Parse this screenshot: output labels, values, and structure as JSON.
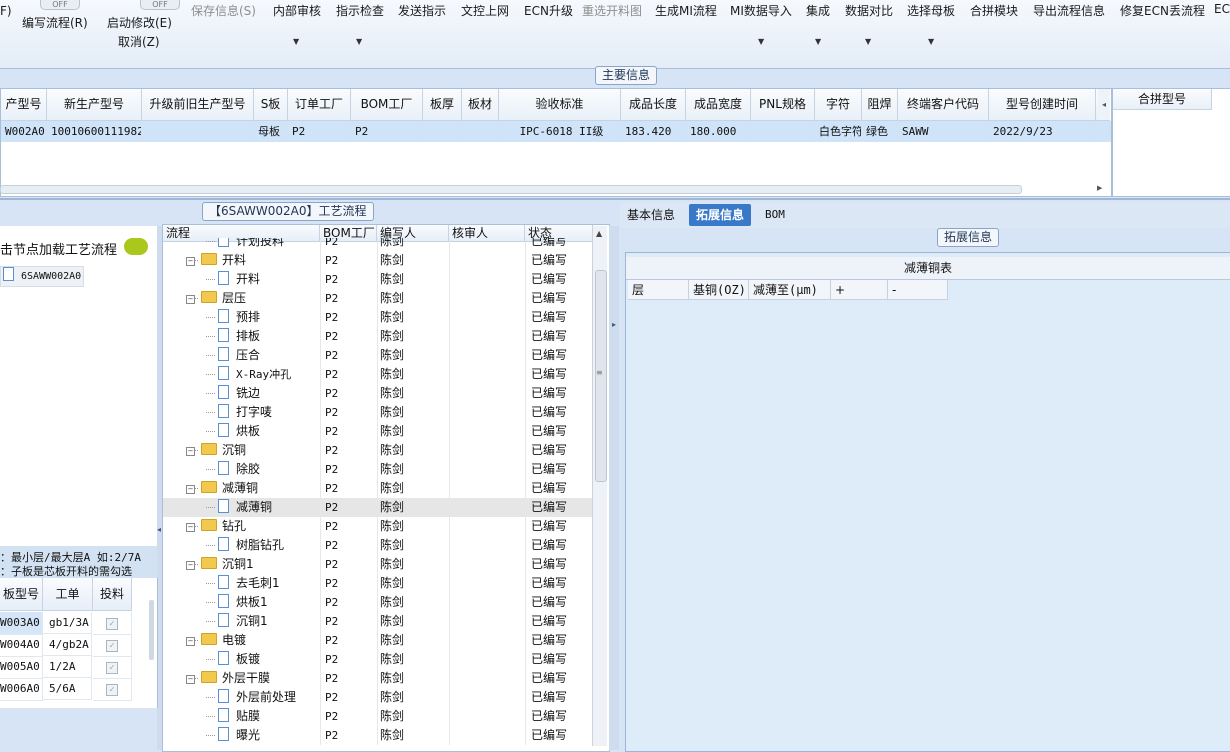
{
  "toolbar": {
    "fragment_left": "F)",
    "toggle_off": "OFF",
    "write_flow": "编写流程(R)",
    "start_modify": "启动修改(E)",
    "cancel": "取消(Z)",
    "save_info": "保存信息(S)",
    "internal_review": "内部审核",
    "indicator_check": "指示检查",
    "send_indicator": "发送指示",
    "doc_upload": "文控上网",
    "ecn_upgrade": "ECN升级",
    "reselect_chart": "重选开料图",
    "gen_mi_flow": "生成MI流程",
    "mi_import": "MI数据导入",
    "integrate": "集成",
    "data_compare": "数据对比",
    "select_mother": "选择母板",
    "merge_module": "合拼模块",
    "export_flow": "导出流程信息",
    "repair_ecn": "修复ECN丢流程",
    "fragment_right": "ECN"
  },
  "main_info": {
    "section_title": "主要信息",
    "columns": [
      "产型号",
      "新生产型号",
      "升级前旧生产型号",
      "S板",
      "订单工厂",
      "BOM工厂",
      "板厚",
      "板材",
      "验收标准",
      "成品长度",
      "成品宽度",
      "PNL规格",
      "字符",
      "阻焊",
      "终端客户代码",
      "型号创建时间"
    ],
    "row": [
      "W002A0",
      "10010600111982",
      "",
      "母板",
      "P2",
      "P2",
      "",
      "",
      "IPC-6018 II级",
      "183.420",
      "180.000",
      "",
      "白色字符",
      "绿色",
      "SAWW",
      "2022/9/23"
    ],
    "right_header": "合拼型号"
  },
  "left_panel": {
    "load_text": "击节点加载工艺流程",
    "tree_node": "6SAWW002A0",
    "hint1": "：最小层/最大层A 如:2/7A",
    "hint2": "：子板是芯板开料的需勾选",
    "grid_headers": [
      "板型号",
      "工单",
      "投料"
    ],
    "grid_rows": [
      {
        "model": "W003A0",
        "order": "gb1/3A"
      },
      {
        "model": "W004A0",
        "order": "4/gb2A"
      },
      {
        "model": "W005A0",
        "order": "1/2A"
      },
      {
        "model": "W006A0",
        "order": "5/6A"
      }
    ]
  },
  "process": {
    "section_title": "【6SAWW002A0】工艺流程",
    "headers": [
      "流程",
      "BOM工厂",
      "编写人",
      "核审人",
      "状态"
    ],
    "rows": [
      {
        "name": "计划投料",
        "type": "leaf",
        "factory": "P2",
        "writer": "陈剑",
        "status": "已编写"
      },
      {
        "name": "开料",
        "type": "group",
        "factory": "P2",
        "writer": "陈剑",
        "status": "已编写"
      },
      {
        "name": "开料",
        "type": "leaf",
        "factory": "P2",
        "writer": "陈剑",
        "status": "已编写"
      },
      {
        "name": "层压",
        "type": "group",
        "factory": "P2",
        "writer": "陈剑",
        "status": "已编写"
      },
      {
        "name": "预排",
        "type": "leaf",
        "factory": "P2",
        "writer": "陈剑",
        "status": "已编写"
      },
      {
        "name": "排板",
        "type": "leaf",
        "factory": "P2",
        "writer": "陈剑",
        "status": "已编写"
      },
      {
        "name": "压合",
        "type": "leaf",
        "factory": "P2",
        "writer": "陈剑",
        "status": "已编写"
      },
      {
        "name": "X-Ray冲孔",
        "type": "leaf",
        "factory": "P2",
        "writer": "陈剑",
        "status": "已编写"
      },
      {
        "name": "铣边",
        "type": "leaf",
        "factory": "P2",
        "writer": "陈剑",
        "status": "已编写"
      },
      {
        "name": "打字唛",
        "type": "leaf",
        "factory": "P2",
        "writer": "陈剑",
        "status": "已编写"
      },
      {
        "name": "烘板",
        "type": "leaf",
        "factory": "P2",
        "writer": "陈剑",
        "status": "已编写"
      },
      {
        "name": "沉铜",
        "type": "group",
        "factory": "P2",
        "writer": "陈剑",
        "status": "已编写"
      },
      {
        "name": "除胶",
        "type": "leaf",
        "factory": "P2",
        "writer": "陈剑",
        "status": "已编写"
      },
      {
        "name": "减薄铜",
        "type": "group",
        "factory": "P2",
        "writer": "陈剑",
        "status": "已编写"
      },
      {
        "name": "减薄铜",
        "type": "leaf",
        "factory": "P2",
        "writer": "陈剑",
        "status": "已编写",
        "selected": true
      },
      {
        "name": "钻孔",
        "type": "group",
        "factory": "P2",
        "writer": "陈剑",
        "status": "已编写"
      },
      {
        "name": "树脂钻孔",
        "type": "leaf",
        "factory": "P2",
        "writer": "陈剑",
        "status": "已编写"
      },
      {
        "name": "沉铜1",
        "type": "group",
        "factory": "P2",
        "writer": "陈剑",
        "status": "已编写"
      },
      {
        "name": "去毛刺1",
        "type": "leaf",
        "factory": "P2",
        "writer": "陈剑",
        "status": "已编写"
      },
      {
        "name": "烘板1",
        "type": "leaf",
        "factory": "P2",
        "writer": "陈剑",
        "status": "已编写"
      },
      {
        "name": "沉铜1",
        "type": "leaf",
        "factory": "P2",
        "writer": "陈剑",
        "status": "已编写"
      },
      {
        "name": "电镀",
        "type": "group",
        "factory": "P2",
        "writer": "陈剑",
        "status": "已编写"
      },
      {
        "name": "板镀",
        "type": "leaf",
        "factory": "P2",
        "writer": "陈剑",
        "status": "已编写"
      },
      {
        "name": "外层干膜",
        "type": "group",
        "factory": "P2",
        "writer": "陈剑",
        "status": "已编写"
      },
      {
        "name": "外层前处理",
        "type": "leaf",
        "factory": "P2",
        "writer": "陈剑",
        "status": "已编写"
      },
      {
        "name": "贴膜",
        "type": "leaf",
        "factory": "P2",
        "writer": "陈剑",
        "status": "已编写"
      },
      {
        "name": "曝光",
        "type": "leaf",
        "factory": "P2",
        "writer": "陈剑",
        "status": "已编写"
      }
    ]
  },
  "right_tabs": {
    "basic": "基本信息",
    "expand": "拓展信息",
    "bom": "BOM"
  },
  "expand_panel": {
    "section_title": "拓展信息",
    "table_title": "减薄铜表",
    "columns": [
      "层",
      "基铜(OZ)",
      "减薄至(μm)",
      "+",
      "-"
    ]
  }
}
